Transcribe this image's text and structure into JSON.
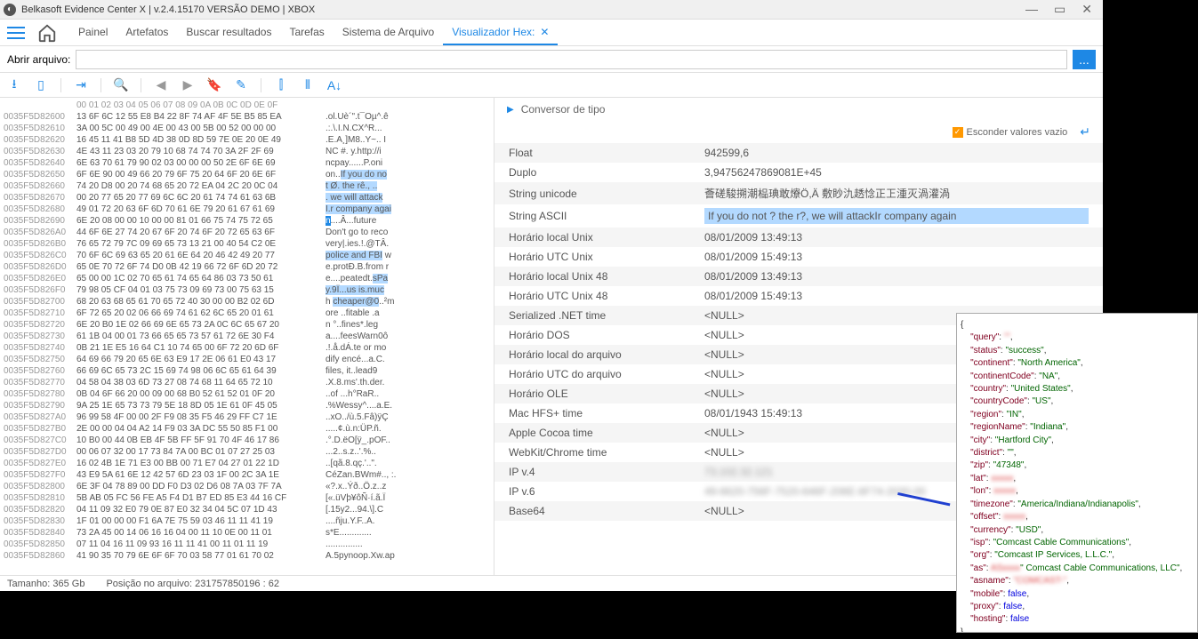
{
  "titlebar": {
    "title": "Belkasoft Evidence Center X | v.2.4.15170 VERSÃO DEMO | XBOX"
  },
  "tabs": [
    "Painel",
    "Artefatos",
    "Buscar resultados",
    "Tarefas",
    "Sistema de Arquivo",
    "Visualizador Hex:"
  ],
  "activeTab": 5,
  "openfile": {
    "label": "Abrir arquivo:",
    "value": "",
    "btn": "..."
  },
  "hex": {
    "header": "00 01 02 03 04 05 06 07 08 09 0A 0B 0C 0D 0E 0F",
    "rows": [
      {
        "a": "0035F5D82600",
        "b": "13 6F 6C 12 55 E8 B4 22 8F 74 AF 4F 5E B5 85 EA",
        "t": ".ol.Uè´\".t¯Oµ^.ê"
      },
      {
        "a": "0035F5D82610",
        "b": "3A 00 5C 00 49 00 4E 00 43 00 5B 00 52 00 00 00",
        "t": ".:.\\.I.N.CX^R..."
      },
      {
        "a": "0035F5D82620",
        "b": "16 45 11 41 B8 5D 4D 38 0D 8D 59 7E 0E 20 0E 49",
        "t": ".E.A¸]M8..Y~.. I"
      },
      {
        "a": "0035F5D82630",
        "b": "4E 43 11 23 03 20 79 10 68 74 74 70 3A 2F 2F 69",
        "t": "NC #. y.http://i"
      },
      {
        "a": "0035F5D82640",
        "b": "6E 63 70 61 79 90 02 03 00 00 00 50 2E 6F 6E 69",
        "t": "ncpay......P.oni"
      },
      {
        "a": "0035F5D82650",
        "b": "6F 6E 90 00 49 66 20 79 6F 75 20 64 6F 20 6E 6F",
        "t": "on..",
        "h1": "If you do no"
      },
      {
        "a": "0035F5D82660",
        "b": "74 20 D8 00 20 74 68 65 20 72 EA 04 2C 20 0C 04",
        "t": "",
        "h1": "t Ø. the rê., .."
      },
      {
        "a": "0035F5D82670",
        "b": "00 20 77 65 20 77 69 6C 6C 20 61 74 74 61 63 6B",
        "t": "",
        "h1": ". we will attack"
      },
      {
        "a": "0035F5D82680",
        "b": "49 01 72 20 63 6F 6D 70 61 6E 79 20 61 67 61 69",
        "t": "",
        "h1": "I.r company agai"
      },
      {
        "a": "0035F5D82690",
        "b": "6E 20 08 00 00 10 00 00 81 01 66 75 74 75 72 65",
        "t": "",
        "h2": "n",
        "t2": "....Â...future"
      },
      {
        "a": "0035F5D826A0",
        "b": "44 6F 6E 27 74 20 67 6F 20 74 6F 20 72 65 63 6F",
        "t": "Don't go to reco"
      },
      {
        "a": "0035F5D826B0",
        "b": "76 65 72 79 7C 09 69 65 73 13 21 00 40 54 C2 0E",
        "t": "very|.ies.!.@TÂ."
      },
      {
        "a": "0035F5D826C0",
        "b": "70 6F 6C 69 63 65 20 61 6E 64 20 46 42 49 20 77",
        "t": "",
        "h1": "police and FBI",
        " t2": " w"
      },
      {
        "a": "0035F5D826D0",
        "b": "65 0E 70 72 6F 74 D0 0B 42 19 66 72 6F 6D 20 72",
        "t": "e.protÐ.B.from r"
      },
      {
        "a": "0035F5D826E0",
        "b": "65 00 00 1C 02 70 65 61 74 65 64 86 03 73 50 61",
        "t": "e....peatedt.",
        "h1": "sPa"
      },
      {
        "a": "0035F5D826F0",
        "b": "79 98 05 CF 04 01 03 75 73 09 69 73 00 75 63 15",
        "t": "",
        "h1": "y.9Ï...us is.muc"
      },
      {
        "a": "0035F5D82700",
        "b": "68 20 63 68 65 61 70 65 72 40 30 00 00 B2 02 6D",
        "t": "h ",
        "h1": "cheaper@0",
        "t2": "..²m"
      },
      {
        "a": "0035F5D82710",
        "b": "6F 72 65 20 02 06 66 69 74 61 62 6C 65 20 01 61",
        "t": "ore ..fitable .a"
      },
      {
        "a": "0035F5D82720",
        "b": "6E 20 B0 1E 02 66 69 6E 65 73 2A 0C 6C 65 67 20",
        "t": "n °..fines*.leg "
      },
      {
        "a": "0035F5D82730",
        "b": "61 1B 04 00 01 73 66 65 65 73 57 61 72 6E 30 F4",
        "t": "a....feesWarn0ô"
      },
      {
        "a": "0035F5D82740",
        "b": "0B 21 1E E5 16 64 C1 10 74 65 00 6F 72 20 6D 6F",
        "t": ".!.å.dÁ.te or mo"
      },
      {
        "a": "0035F5D82750",
        "b": "64 69 66 79 20 65 6E 63 E9 17 2E 06 61 E0 43 17",
        "t": "dify encé...a.C."
      },
      {
        "a": "0035F5D82760",
        "b": "66 69 6C 65 73 2C 15 69 74 98 06 6C 65 61 64 39",
        "t": "files, it..lead9"
      },
      {
        "a": "0035F5D82770",
        "b": "04 58 04 38 03 6D 73 27 08 74 68 11 64 65 72 10",
        "t": ".X.8.ms'.th.der."
      },
      {
        "a": "0035F5D82780",
        "b": "0B 04 6F 66 20 00 09 00 68 B0 52 61 52 01 0F 20",
        "t": "..of ...h°RaR.. "
      },
      {
        "a": "0035F5D82790",
        "b": "9A 25 1E 65 73 73 79 5E 18 8D 05 1E 61 0F 45 05",
        "t": ".%Wessy^....a.E."
      },
      {
        "a": "0035F5D827A0",
        "b": "96 99 58 4F 00 00 2F F9 08 35 F5 46 29 FF C7 1E",
        "t": "..xO../ù.5.Fâ)ÿÇ"
      },
      {
        "a": "0035F5D827B0",
        "b": "2E 00 00 04 04 A2 14 F9 03 3A DC 55 50 85 F1 00",
        "t": ".....¢.ù.n:ÜP.ñ."
      },
      {
        "a": "0035F5D827C0",
        "b": "10 B0 00 44 0B EB 4F 5B FF 5F 91 70 4F 46 17 86",
        "t": ".°.D.ëO[ÿ_.pOF.."
      },
      {
        "a": "0035F5D827D0",
        "b": "00 06 07 32 00 17 73 84 7A 00 BC 01 07 27 25 03",
        "t": "...2..s.z..'.%.."
      },
      {
        "a": "0035F5D827E0",
        "b": "16 02 4B 1E 71 E3 00 BB 00 71 E7 04 27 01 22 1D",
        "t": "..[qã.8.qç.'..\"."
      },
      {
        "a": "0035F5D827F0",
        "b": "43 E9 5A 61 6E 12 42 57 6D 23 03 1F 00 2C 3A 1E",
        "t": "CéZan.BWm#.., :."
      },
      {
        "a": "0035F5D82800",
        "b": "6E 3F 04 78 89 00 DD F0 D3 02 D6 08 7A 03 7F 7A",
        "t": "«?.x..Ýð..Ö.z..z"
      },
      {
        "a": "0035F5D82810",
        "b": "5B AB 05 FC 56 FE A5 F4 D1 B7 ED 85 E3 44 16 CF",
        "t": "[«.üVþ¥ôÑ·í.ã.Ï"
      },
      {
        "a": "0035F5D82820",
        "b": "04 11 09 32 E0 79 0E 87 E0 32 34 04 5C 07 1D 43",
        "t": "[.15y2...94.\\].C"
      },
      {
        "a": "0035F5D82830",
        "b": "1F 01 00 00 00 F1 6A 7E 75 59 03 46 11 11 41 19",
        "t": "....ñju.Y.F..A."
      },
      {
        "a": "0035F5D82840",
        "b": "73 2A 45 00 14 06 16 16 04 00 11 10 0E 00 11 01",
        "t": "s*E............."
      },
      {
        "a": "0035F5D82850",
        "b": "07 11 04 16 11 09 93 16 11 11 41 00 11 01 11 19",
        "t": "..............."
      },
      {
        "a": "0035F5D82860",
        "b": "41 90 35 70 79 6E 6F 6F 70 03 58 77 01 61 70 02",
        "t": "A.5pynoop.Xw.ap"
      }
    ]
  },
  "converter": {
    "title": "Conversor de tipo",
    "hide": "Esconder valores vazio",
    "rows": [
      {
        "k": "Float",
        "v": "942599,6"
      },
      {
        "k": "Duplo",
        "v": "3,94756247869081E+45"
      },
      {
        "k": "String unicode",
        "v": "薈磋駿搠潮榀琠敢爎Ö,Ä 敷眇氿䞬惗正㠪湩灭渦灌渦"
      },
      {
        "k": "String ASCII",
        "v": "If you do not ? the r?, we will attackIr company again",
        "hl": true
      },
      {
        "k": "Horário local Unix",
        "v": "08/01/2009 13:49:13"
      },
      {
        "k": "Horário UTC Unix",
        "v": "08/01/2009 15:49:13"
      },
      {
        "k": "Horário local Unix 48",
        "v": "08/01/2009 13:49:13"
      },
      {
        "k": "Horário UTC Unix 48",
        "v": "08/01/2009 15:49:13"
      },
      {
        "k": "Serialized .NET time",
        "v": "<NULL>"
      },
      {
        "k": "Horário DOS",
        "v": "<NULL>"
      },
      {
        "k": "Horário local do arquivo",
        "v": "<NULL>"
      },
      {
        "k": "Horário UTC do arquivo",
        "v": "<NULL>"
      },
      {
        "k": "Horário OLE",
        "v": "<NULL>"
      },
      {
        "k": "Mac HFS+ time",
        "v": "08/01/1943 15:49:13"
      },
      {
        "k": "Apple Cocoa time",
        "v": "<NULL>"
      },
      {
        "k": "WebKit/Chrome time",
        "v": "<NULL>"
      },
      {
        "k": "IP v.4",
        "v": "73.102.32.121",
        "blur": true
      },
      {
        "k": "IP v.6",
        "v": "49-6620-756F-7520-646F-206E-6F74-2030-00",
        "blur": true
      },
      {
        "k": "Base64",
        "v": "<NULL>"
      }
    ]
  },
  "status": {
    "size": "Tamanho: 365 Gb",
    "pos": "Posição no arquivo: 231757850196 : 62"
  },
  "json_overlay": {
    "lines": [
      [
        "{",
        ""
      ],
      [
        "    \"query\": ",
        "\"\"",
        "blur",
        ","
      ],
      [
        "    \"status\": ",
        "\"success\"",
        "",
        ","
      ],
      [
        "    \"continent\": ",
        "\"North America\"",
        "",
        ","
      ],
      [
        "    \"continentCode\": ",
        "\"NA\"",
        "",
        ","
      ],
      [
        "    \"country\": ",
        "\"United States\"",
        "",
        ","
      ],
      [
        "    \"countryCode\": ",
        "\"US\"",
        "",
        ","
      ],
      [
        "    \"region\": ",
        "\"IN\"",
        "",
        ","
      ],
      [
        "    \"regionName\": ",
        "\"Indiana\"",
        "",
        ","
      ],
      [
        "    \"city\": ",
        "\"Hartford City\"",
        "",
        ","
      ],
      [
        "    \"district\": ",
        "\"\"",
        "",
        ","
      ],
      [
        "    \"zip\": ",
        "\"47348\"",
        "",
        ","
      ],
      [
        "    \"lat\": ",
        "",
        "blur",
        ","
      ],
      [
        "    \"lon\": ",
        "",
        "blur",
        ","
      ],
      [
        "    \"timezone\": ",
        "\"America/Indiana/Indianapolis\"",
        "",
        ","
      ],
      [
        "    \"offset\": ",
        "",
        "blur",
        ","
      ],
      [
        "    \"currency\": ",
        "\"USD\"",
        "",
        ","
      ],
      [
        "    \"isp\": ",
        "\"Comcast Cable Communications\"",
        "",
        ","
      ],
      [
        "    \"org\": ",
        "\"Comcast IP Services, L.L.C.\"",
        "",
        ","
      ],
      [
        "    \"as\": \"",
        "blurtxt",
        "\" Comcast Cable Communications, LLC\"",
        ","
      ],
      [
        "    \"asname\": ",
        "\"COMCAST-\"",
        "blur",
        ","
      ],
      [
        "    \"mobile\": ",
        "false",
        "bool",
        ","
      ],
      [
        "    \"proxy\": ",
        "false",
        "bool",
        ","
      ],
      [
        "    \"hosting\": ",
        "false",
        "bool",
        ""
      ],
      [
        "}",
        ""
      ]
    ]
  }
}
